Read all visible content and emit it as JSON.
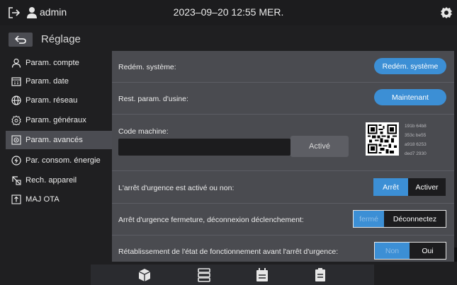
{
  "header": {
    "username": "admin",
    "datetime": "2023–09–20 12:55 MER.",
    "icons": [
      "logout-icon",
      "user-icon",
      "gear-icon"
    ]
  },
  "title": {
    "back_icon": "undo-arrow-icon",
    "text": "Réglage"
  },
  "sidebar": {
    "items": [
      {
        "label": "Param. compte",
        "icon": "person-icon",
        "active": false
      },
      {
        "label": "Param. date",
        "icon": "calendar-icon",
        "active": false
      },
      {
        "label": "Param. réseau",
        "icon": "globe-icon",
        "active": false
      },
      {
        "label": "Param. généraux",
        "icon": "settings-icon",
        "active": false
      },
      {
        "label": "Param. avancés",
        "icon": "advanced-settings-icon",
        "active": true
      },
      {
        "label": "Par. consom. énergie",
        "icon": "energy-icon",
        "active": false
      },
      {
        "label": "Rech. appareil",
        "icon": "search-device-icon",
        "active": false
      },
      {
        "label": "MAJ OTA",
        "icon": "upload-icon",
        "active": false
      }
    ]
  },
  "main": {
    "restart": {
      "label": "Redém. système:",
      "button": "Redém. système"
    },
    "factory_reset": {
      "label": "Rest. param. d'usine:",
      "button": "Maintenant"
    },
    "machine_code": {
      "label": "Code machine:",
      "value": "",
      "activate_button": "Activé",
      "code_lines": [
        "191b 64b8",
        "353c be55",
        "a918 6253",
        "ded7 2930"
      ]
    },
    "emergency_stop": {
      "label": "L'arrêt d'urgence est activé ou non:",
      "options": [
        "Arrêt",
        "Activer"
      ],
      "selected": "Arrêt"
    },
    "emergency_close": {
      "label": "Arrêt d'urgence fermeture, déconnexion déclenchement:",
      "options": [
        "fermé",
        "Déconnectez"
      ],
      "selected": "fermé"
    },
    "restore_state": {
      "label": "Rétablissement de l'état de fonctionnement avant l'arrêt d'urgence:",
      "options": [
        "Non",
        "Oui"
      ],
      "selected": "Non"
    }
  },
  "bottom_nav": {
    "icons": [
      "cube-icon",
      "server-list-icon",
      "calendar-icon",
      "clipboard-icon"
    ]
  },
  "colors": {
    "accent": "#3c8fd5",
    "panel": "#4a4b50",
    "background": "#1f1f21",
    "active_sidebar": "#4b4c52"
  }
}
